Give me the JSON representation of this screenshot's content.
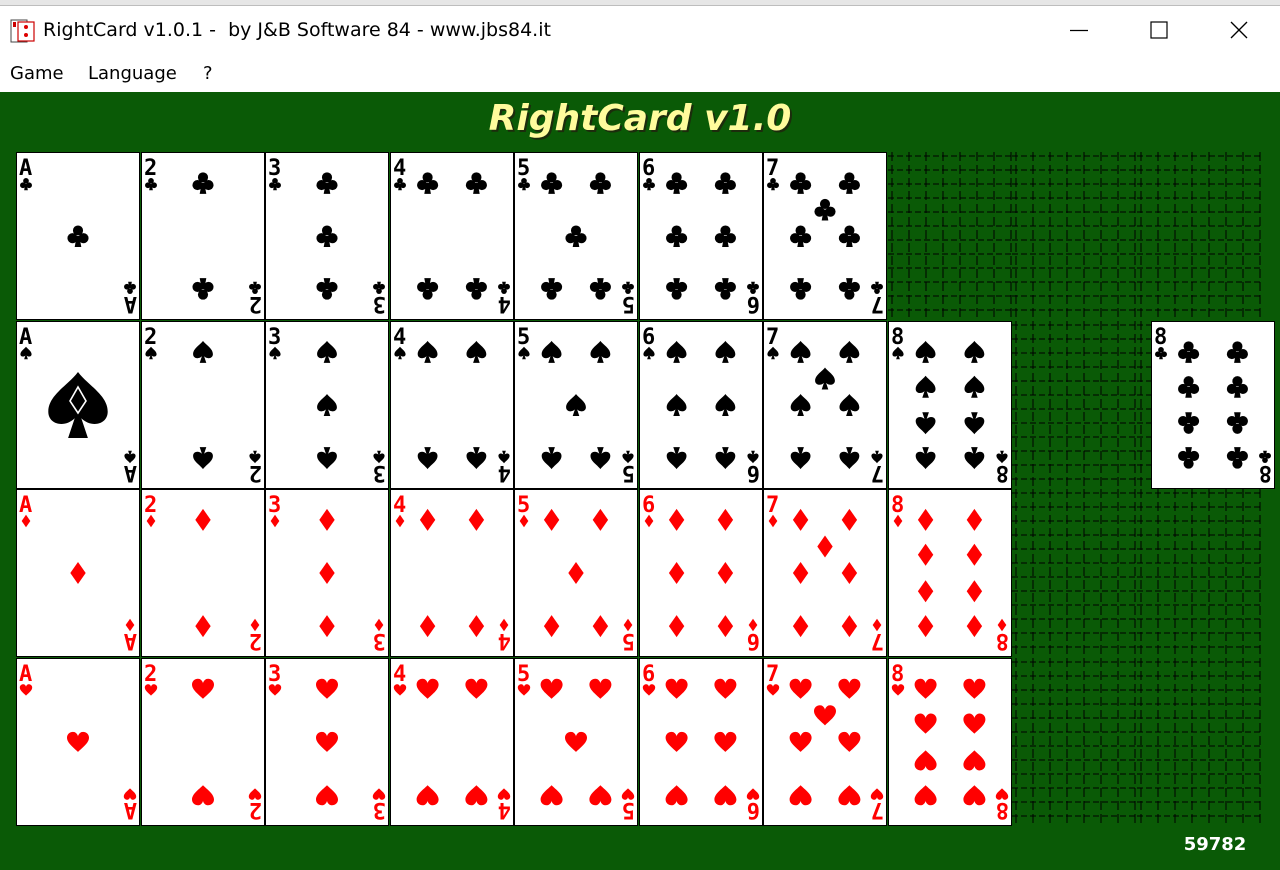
{
  "window": {
    "title": "RightCard v1.0.1 -  by J&B Software 84 - www.jbs84.it",
    "app_icon": "playing-card-icon",
    "controls": [
      "minimize-icon",
      "maximize-icon",
      "close-icon"
    ]
  },
  "menu": [
    {
      "label": "Game"
    },
    {
      "label": "Language"
    },
    {
      "label": "?"
    }
  ],
  "game": {
    "title": "RightCard v1.0",
    "score": "59782",
    "colors": {
      "table": "#0a5a06",
      "title": "#fffb9c",
      "red_suit": "#ff0000",
      "black_suit": "#000000",
      "empty_slot_pattern": "#000000"
    },
    "rows": [
      {
        "suit": "clubs",
        "cells": [
          "A",
          "2",
          "3",
          "4",
          "5",
          "6",
          "7",
          null,
          null,
          null
        ]
      },
      {
        "suit": "spades",
        "cells": [
          "A",
          "2",
          "3",
          "4",
          "5",
          "6",
          "7",
          "8",
          null,
          null
        ]
      },
      {
        "suit": "diamonds",
        "cells": [
          "A",
          "2",
          "3",
          "4",
          "5",
          "6",
          "7",
          "8",
          null,
          null
        ]
      },
      {
        "suit": "hearts",
        "cells": [
          "A",
          "2",
          "3",
          "4",
          "5",
          "6",
          "7",
          "8",
          null,
          null
        ]
      }
    ],
    "extra_card": {
      "rank": "8",
      "suit": "clubs"
    }
  }
}
